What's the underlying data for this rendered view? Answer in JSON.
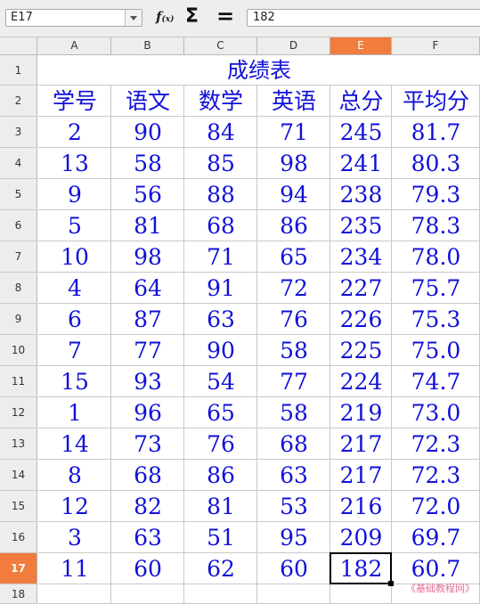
{
  "name_box": "E17",
  "formula_bar": {
    "fx_icon": "function-wizard-icon",
    "sigma_icon": "sum-icon",
    "equals_icon": "formula-icon",
    "content": "182"
  },
  "columns": [
    "A",
    "B",
    "C",
    "D",
    "E",
    "F"
  ],
  "active_column": "E",
  "row_numbers": [
    "1",
    "2",
    "3",
    "4",
    "5",
    "6",
    "7",
    "8",
    "9",
    "10",
    "11",
    "12",
    "13",
    "14",
    "15",
    "16",
    "17",
    "18"
  ],
  "active_row": "17",
  "sheet": {
    "title": "成绩表",
    "headers": [
      "学号",
      "语文",
      "数学",
      "英语",
      "总分",
      "平均分"
    ],
    "rows": [
      [
        "2",
        "90",
        "84",
        "71",
        "245",
        "81.7"
      ],
      [
        "13",
        "58",
        "85",
        "98",
        "241",
        "80.3"
      ],
      [
        "9",
        "56",
        "88",
        "94",
        "238",
        "79.3"
      ],
      [
        "5",
        "81",
        "68",
        "86",
        "235",
        "78.3"
      ],
      [
        "10",
        "98",
        "71",
        "65",
        "234",
        "78.0"
      ],
      [
        "4",
        "64",
        "91",
        "72",
        "227",
        "75.7"
      ],
      [
        "6",
        "87",
        "63",
        "76",
        "226",
        "75.3"
      ],
      [
        "7",
        "77",
        "90",
        "58",
        "225",
        "75.0"
      ],
      [
        "15",
        "93",
        "54",
        "77",
        "224",
        "74.7"
      ],
      [
        "1",
        "96",
        "65",
        "58",
        "219",
        "73.0"
      ],
      [
        "14",
        "73",
        "76",
        "68",
        "217",
        "72.3"
      ],
      [
        "8",
        "68",
        "86",
        "63",
        "217",
        "72.3"
      ],
      [
        "12",
        "82",
        "81",
        "53",
        "216",
        "72.0"
      ],
      [
        "3",
        "63",
        "51",
        "95",
        "209",
        "69.7"
      ],
      [
        "11",
        "60",
        "62",
        "60",
        "182",
        "60.7"
      ]
    ]
  },
  "text_color": "#1010d8",
  "active_header_color": "#f07c3e",
  "watermark": "《基础教程网》"
}
